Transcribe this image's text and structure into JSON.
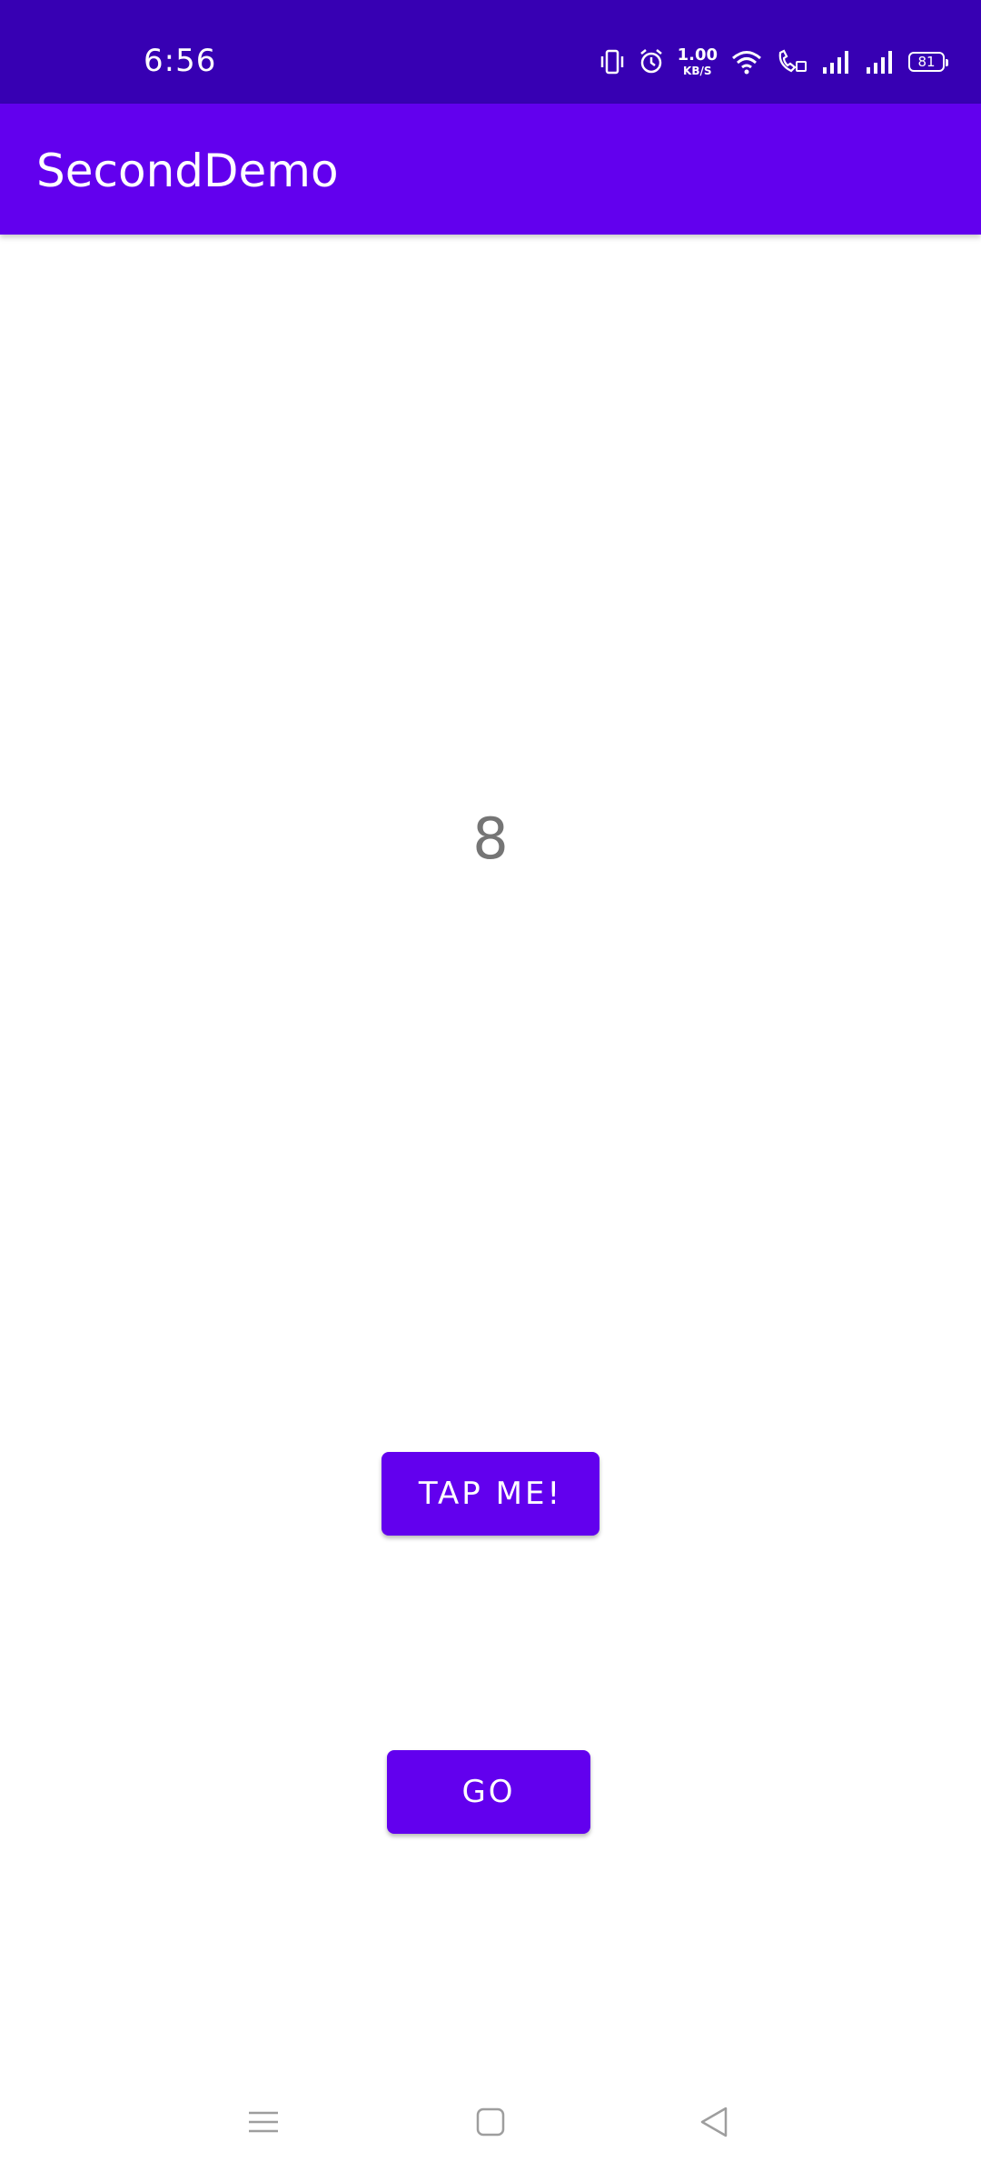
{
  "status_bar": {
    "time": "6:56",
    "net_speed_value": "1.00",
    "net_speed_unit": "KB/S",
    "battery": "81",
    "icons": [
      "vibrate-icon",
      "alarm-icon",
      "wifi-icon",
      "wifi-calling-icon",
      "signal-icon",
      "signal-icon"
    ]
  },
  "app_bar": {
    "title": "SecondDemo"
  },
  "main": {
    "counter_value": "8",
    "tap_button_label": "TAP ME!",
    "go_button_label": "GO"
  },
  "nav_bar": {
    "icons": [
      "menu-icon",
      "home-icon",
      "back-icon"
    ]
  },
  "colors": {
    "status_bar": "#3700b3",
    "app_bar": "#6200ee",
    "button": "#6200ee",
    "counter_text": "#757575",
    "nav_icons": "#9e9e9e"
  }
}
